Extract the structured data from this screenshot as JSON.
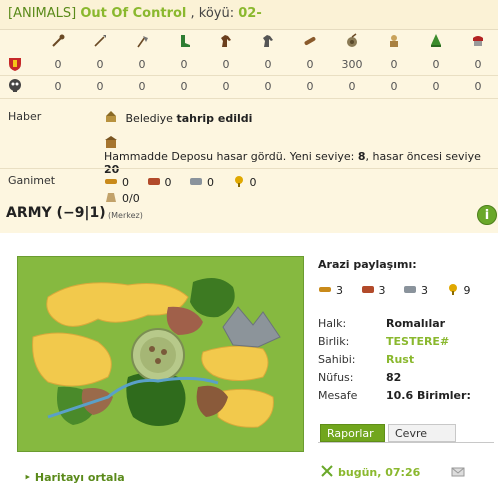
{
  "report": {
    "title": {
      "tag": "[ANIMALS]",
      "alliance": "Out Of Control",
      "separator": ", köyü:",
      "village": "02-"
    },
    "unit_icons": [
      "club-icon",
      "spear-icon",
      "axe-icon",
      "scout-boot-icon",
      "horse-icon",
      "knight-horse-icon",
      "ram-icon",
      "catapult-icon",
      "chief-icon",
      "settler-icon",
      "hero-icon"
    ],
    "troops": {
      "row_icon": "shield-icon",
      "counts": [
        "0",
        "0",
        "0",
        "0",
        "0",
        "0",
        "0",
        "300",
        "0",
        "0",
        "0"
      ]
    },
    "losses": {
      "row_icon": "skull-icon",
      "counts": [
        "0",
        "0",
        "0",
        "0",
        "0",
        "0",
        "0",
        "0",
        "0",
        "0",
        "0"
      ]
    },
    "news": {
      "label": "Haber",
      "line1_prefix": "Belediye",
      "line1_bold": "tahrip edildi",
      "line2_prefix": "Hammadde Deposu hasar gördü. Yeni seviye:",
      "line2_new_level": "8",
      "line2_middle": ", hasar öncesi seviye",
      "line2_old_level": "20"
    },
    "loot": {
      "label": "Ganimet",
      "wood": "0",
      "clay": "0",
      "iron": "0",
      "crop": "0",
      "carry": "0/0"
    }
  },
  "army": {
    "title": "ARMY (−9|1)",
    "subtitle": "(Merkez)",
    "info_button": "i"
  },
  "side": {
    "share_title": "Arazi paylaşımı:",
    "share": {
      "wood": "3",
      "clay": "3",
      "iron": "3",
      "crop": "9"
    },
    "details": [
      {
        "key": "Halk:",
        "value": "Romalılar"
      },
      {
        "key": "Birlik:",
        "value": "TESTERE#"
      },
      {
        "key": "Sahibi:",
        "value": "Rust"
      },
      {
        "key": "Nüfus:",
        "value": "82"
      },
      {
        "key": "Mesafe",
        "value": "10.6 Birimler:"
      }
    ],
    "tabs": [
      "Raporlar",
      "Cevre"
    ],
    "time": "bugün, 07:26"
  },
  "center_link": "Haritayı ortala",
  "colors": {
    "accent_green": "#8ab82e",
    "tab_green": "#71a61d",
    "report_bg": "#fdf6e0"
  }
}
